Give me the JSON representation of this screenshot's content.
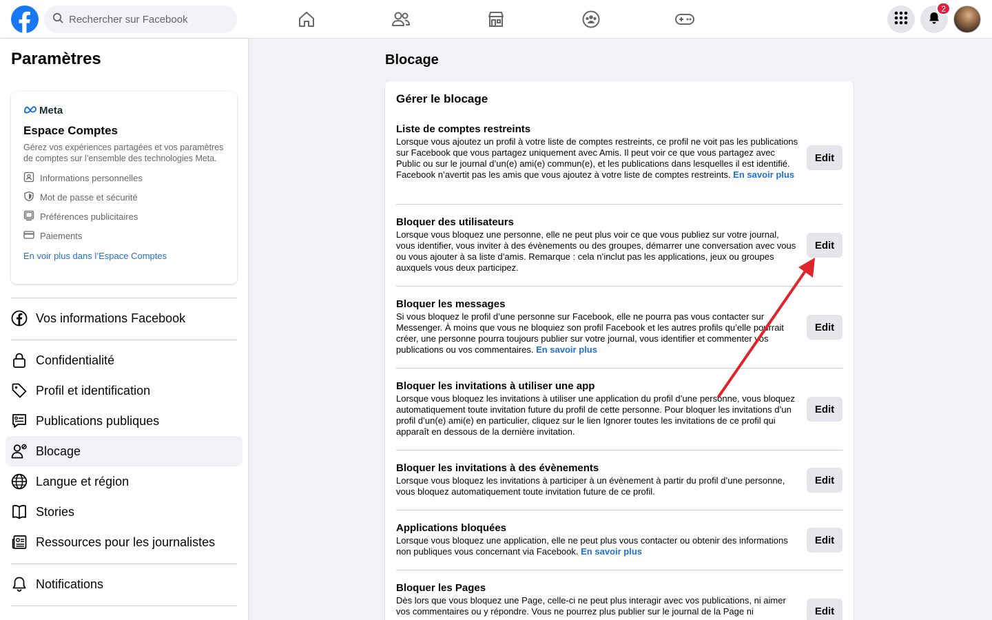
{
  "search": {
    "placeholder": "Rechercher sur Facebook"
  },
  "header": {
    "notifications_count": "2",
    "nav_icons": [
      "home-icon",
      "friends-icon",
      "marketplace-icon",
      "groups-icon",
      "gaming-icon"
    ]
  },
  "sidebar": {
    "title": "Paramètres",
    "meta_card": {
      "brand": "Meta",
      "title": "Espace Comptes",
      "description": "Gérez vos expériences partagées et vos paramètres de comptes sur l’ensemble des technologies Meta.",
      "items": [
        {
          "label": "Informations personnelles",
          "icon": "id-card-icon"
        },
        {
          "label": "Mot de passe et sécurité",
          "icon": "shield-icon"
        },
        {
          "label": "Préférences publicitaires",
          "icon": "monitor-icon"
        },
        {
          "label": "Paiements",
          "icon": "credit-card-icon"
        }
      ],
      "link": "En voir plus dans l’Espace Comptes"
    },
    "items": [
      {
        "label": "Vos informations Facebook",
        "icon": "facebook-icon"
      },
      {
        "label": "Confidentialité",
        "icon": "lock-icon"
      },
      {
        "label": "Profil et identification",
        "icon": "tag-icon"
      },
      {
        "label": "Publications publiques",
        "icon": "public-post-icon"
      },
      {
        "label": "Blocage",
        "icon": "blocked-user-icon",
        "active": true
      },
      {
        "label": "Langue et région",
        "icon": "globe-icon"
      },
      {
        "label": "Stories",
        "icon": "book-icon"
      },
      {
        "label": "Ressources pour les journalistes",
        "icon": "newspaper-icon"
      },
      {
        "label": "Notifications",
        "icon": "bell-icon"
      }
    ]
  },
  "main": {
    "title": "Blocage",
    "card_title": "Gérer le blocage",
    "edit_label": "Edit",
    "sections": [
      {
        "title": "Liste de comptes restreints",
        "desc": "Lorsque vous ajoutez un profil à votre liste de comptes restreints, ce profil ne voit pas les publications sur Facebook que vous partagez uniquement avec Amis. Il peut voir ce que vous partagez avec Public ou sur le journal d’un(e) ami(e) commun(e), et les publications dans lesquelles il est identifié. Facebook n’avertit pas les amis que vous ajoutez à votre liste de comptes restreints.",
        "link": "En savoir plus"
      },
      {
        "title": "Bloquer des utilisateurs",
        "desc": "Lorsque vous bloquez une personne, elle ne peut plus voir ce que vous publiez sur votre journal, vous identifier, vous inviter à des évènements ou des groupes, démarrer une conversation avec vous ou vous ajouter à sa liste d’amis. Remarque : cela n’inclut pas les applications, jeux ou groupes auxquels vous deux participez.",
        "link": ""
      },
      {
        "title": "Bloquer les messages",
        "desc": "Si vous bloquez le profil d’une personne sur Facebook, elle ne pourra pas vous contacter sur Messenger. À moins que vous ne bloquiez son profil Facebook et les autres profils qu’elle pourrait créer, une personne pourra toujours publier sur votre journal, vous identifier et commenter vos publications ou vos commentaires.",
        "link": "En savoir plus"
      },
      {
        "title": "Bloquer les invitations à utiliser une app",
        "desc": "Lorsque vous bloquez les invitations à utiliser une application du profil d’une personne, vous bloquez automatiquement toute invitation future du profil de cette personne. Pour bloquer les invitations d’un profil d’un(e) ami(e) en particulier, cliquez sur le lien Ignorer toutes les invitations de ce profil qui apparaît en dessous de la dernière invitation.",
        "link": ""
      },
      {
        "title": "Bloquer les invitations à des évènements",
        "desc": "Lorsque vous bloquez les invitations à participer à un évènement à partir du profil d’une personne, vous bloquez automatiquement toute invitation future de ce profil.",
        "link": ""
      },
      {
        "title": "Applications bloquées",
        "desc": "Lorsque vous bloquez une application, elle ne peut plus vous contacter ou obtenir des informations non publiques vous concernant via Facebook.",
        "link": "En savoir plus"
      },
      {
        "title": "Bloquer les Pages",
        "desc": "Dès lors que vous bloquez une Page, celle-ci ne peut plus interagir avec vos publications, ni aimer vos commentaires ou y répondre. Vous ne pourrez plus publier sur le journal de la Page ni",
        "link": ""
      }
    ]
  },
  "colors": {
    "brand": "#1877f2",
    "link": "#216fdb",
    "annotation_arrow": "#e0242b",
    "badge": "#e41e3f"
  }
}
